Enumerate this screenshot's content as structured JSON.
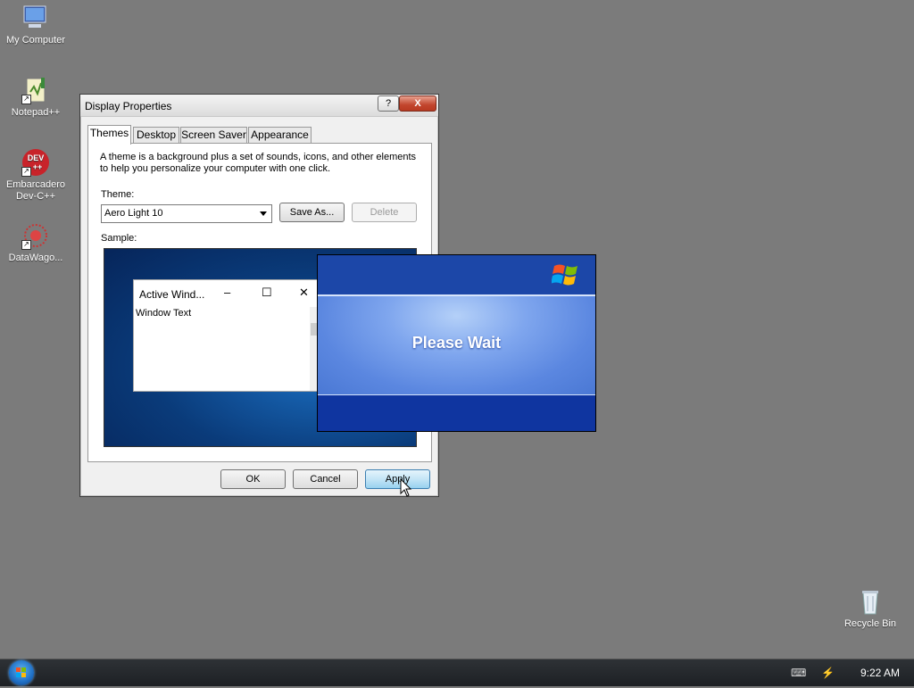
{
  "desktop": {
    "icons": [
      {
        "label": "My Computer",
        "icon": "computer-icon"
      },
      {
        "label": "Notepad++",
        "icon": "notepad-plus-plus-icon"
      },
      {
        "label": "Embarcadero Dev-C++",
        "icon": "devcpp-icon",
        "badge": "DEV\n++"
      },
      {
        "label": "DataWago...",
        "icon": "datawago-icon"
      },
      {
        "label": "Recycle Bin",
        "icon": "recycle-bin-icon"
      }
    ]
  },
  "dialog": {
    "title": "Display Properties",
    "help_button": "?",
    "close_button": "X",
    "tabs": [
      {
        "label": "Themes",
        "active": true
      },
      {
        "label": "Desktop",
        "active": false
      },
      {
        "label": "Screen Saver",
        "active": false
      },
      {
        "label": "Appearance",
        "active": false
      }
    ],
    "description": "A theme is a background plus a set of sounds, icons, and other elements to help you personalize your computer with one click.",
    "theme_label": "Theme:",
    "theme_value": "Aero Light 10",
    "save_as": "Save As...",
    "delete": "Delete",
    "sample_label": "Sample:",
    "sample_window": {
      "title": "Active Wind...",
      "minimize": "–",
      "maximize": "☐",
      "close": "✕",
      "text": "Window Text"
    },
    "ok": "OK",
    "cancel": "Cancel",
    "apply": "Apply"
  },
  "splash": {
    "message": "Please Wait"
  },
  "taskbar": {
    "clock": "9:22 AM"
  },
  "colors": {
    "desktop_bg": "#7b7b7b",
    "splash_blue": "#1a3fa0",
    "splash_light": "#7fa6ee"
  }
}
